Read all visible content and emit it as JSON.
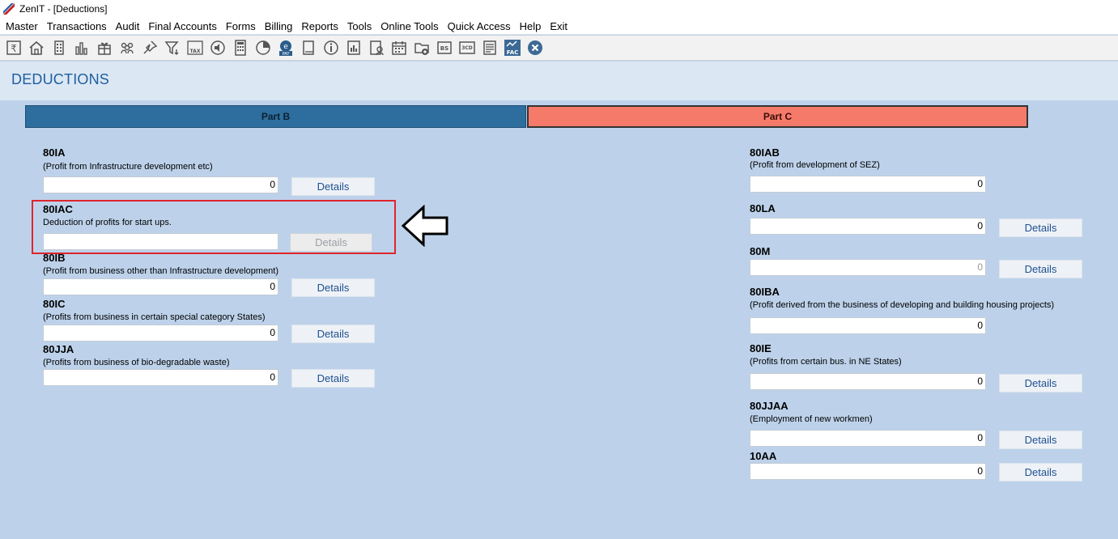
{
  "window": {
    "title": "ZenIT - [Deductions]"
  },
  "menu": [
    "Master",
    "Transactions",
    "Audit",
    "Final Accounts",
    "Forms",
    "Billing",
    "Reports",
    "Tools",
    "Online Tools",
    "Quick Access",
    "Help",
    "Exit"
  ],
  "toolbar_icons": [
    "rupee-icon",
    "home-icon",
    "building-icon",
    "bar-chart-icon",
    "gift-icon",
    "group-icon",
    "pin-icon",
    "filter-icon",
    "tax-icon",
    "speaker-icon",
    "calculator-icon",
    "pie-icon",
    "epay-icon",
    "book-icon",
    "info-icon",
    "report-icon",
    "user-card-icon",
    "calendar-icon",
    "folder-add-icon",
    "bs-icon",
    "3cd-icon",
    "form-icon",
    "fac-icon",
    "close-icon"
  ],
  "toolbar_text": {
    "tax": "TAX",
    "pay": "PAY",
    "bs": "BS",
    "cd": "3CD",
    "fac": "FAC"
  },
  "page": {
    "title": "DEDUCTIONS"
  },
  "tabs": {
    "part_b": "Part B",
    "part_c": "Part C"
  },
  "details_label": "Details",
  "part_b": {
    "s80ia": {
      "code": "80IA",
      "desc": "(Profit from Infrastructure development etc)",
      "value": "0"
    },
    "s80iac": {
      "code": "80IAC",
      "desc": "Deduction of profits for start ups.",
      "value": ""
    },
    "s80ib": {
      "code": "80IB",
      "desc": "(Profit from business other than Infrastructure development)",
      "value": "0"
    },
    "s80ic": {
      "code": "80IC",
      "desc": "(Profits from business in certain special category States)",
      "value": "0"
    },
    "s80jja": {
      "code": "80JJA",
      "desc": "(Profits from business of bio-degradable waste)",
      "value": "0"
    }
  },
  "part_c": {
    "s80iab": {
      "code": "80IAB",
      "desc": "(Profit from development of SEZ)",
      "value": "0"
    },
    "s80la": {
      "code": "80LA",
      "desc": "",
      "value": "0"
    },
    "s80m": {
      "code": "80M",
      "desc": "",
      "value": "0"
    },
    "s80iba": {
      "code": "80IBA",
      "desc": "(Profit derived from the business of developing and building housing projects)",
      "value": "0"
    },
    "s80ie": {
      "code": "80IE",
      "desc": "(Profits from certain bus. in NE States)",
      "value": "0"
    },
    "s80jjaa": {
      "code": "80JJAA",
      "desc": "(Employment of new workmen)",
      "value": "0"
    },
    "s10aa": {
      "code": "10AA",
      "desc": "",
      "value": "0"
    }
  }
}
